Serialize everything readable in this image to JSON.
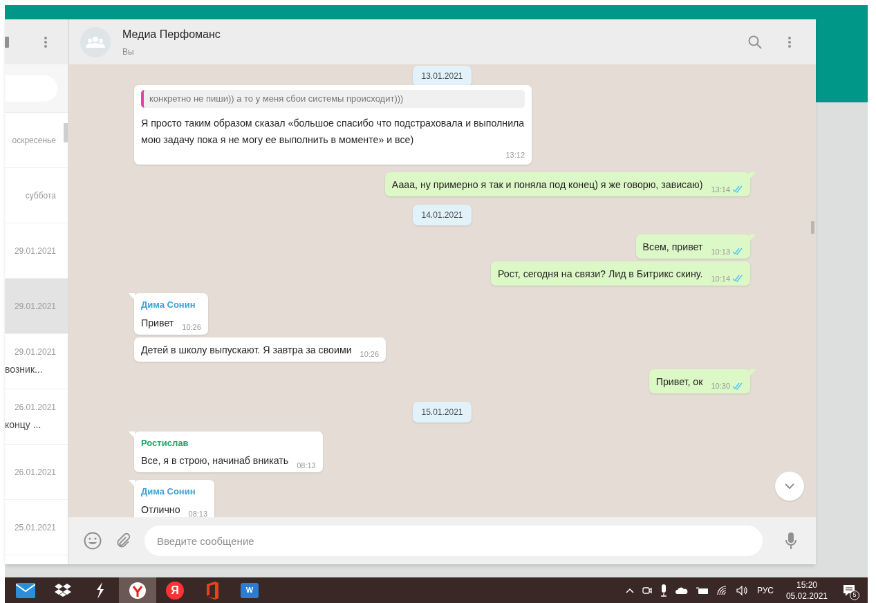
{
  "sidebar": {
    "items": [
      {
        "date": "оскресенье",
        "selected": false
      },
      {
        "date": "суббота",
        "selected": false
      },
      {
        "date": "29.01.2021",
        "selected": false
      },
      {
        "date": "29.01.2021",
        "selected": true
      },
      {
        "date": "29.01.2021",
        "preview": "возник...",
        "selected": false
      },
      {
        "date": "26.01.2021",
        "preview": "концу ...",
        "selected": false
      },
      {
        "date": "26.01.2021",
        "selected": false
      },
      {
        "date": "25.01.2021",
        "selected": false
      }
    ]
  },
  "chat": {
    "title": "Медиа Перфоманс",
    "subtitle": "Вы",
    "messages": [
      {
        "kind": "date",
        "text": "13.01.2021"
      },
      {
        "kind": "in",
        "quote": "конкретно не пиши)) а то у меня сбои системы происходит)))",
        "text": "Я просто таким образом сказал «большое спасибо что подстраховала и выполнила мою задачу пока я не могу ее выполнить в моменте» и все)",
        "time": "13:12",
        "tail": false
      },
      {
        "kind": "out",
        "text": "Аааа, ну примерно я так и поняла под конец) я же говорю, зависаю)",
        "time": "13:14",
        "tail": true
      },
      {
        "kind": "date",
        "text": "14.01.2021"
      },
      {
        "kind": "out",
        "text": "Всем, привет",
        "time": "10:13",
        "tail": true
      },
      {
        "kind": "out",
        "text": "Рост, сегодня на связи? Лид в Битрикс скину.",
        "time": "10:14",
        "tail": false
      },
      {
        "kind": "in",
        "sender": "Дима Сонин",
        "color": "#35a3d5",
        "text": "Привет",
        "time": "10:26",
        "tail": true
      },
      {
        "kind": "in",
        "text": "Детей в школу выпускают. Я завтра за своими",
        "time": "10:26",
        "tail": false
      },
      {
        "kind": "out",
        "text": "Привет, ок",
        "time": "10:30",
        "tail": true
      },
      {
        "kind": "date",
        "text": "15.01.2021"
      },
      {
        "kind": "in",
        "sender": "Ростислав",
        "color": "#1fa463",
        "text": "Все, я в строю, начинаб вникать",
        "time": "08:13",
        "tail": true
      },
      {
        "kind": "in",
        "sender": "Дима Сонин",
        "color": "#35a3d5",
        "text": "Отлично",
        "time": "08:13",
        "tail": true
      }
    ],
    "composer": {
      "placeholder": "Введите сообщение"
    }
  },
  "taskbar": {
    "apps": [
      {
        "kind": "mail",
        "selected": false
      },
      {
        "kind": "dropbox",
        "selected": false
      },
      {
        "kind": "bolt",
        "selected": false
      },
      {
        "kind": "browser",
        "selected": true
      },
      {
        "kind": "letter",
        "glyph": "Я",
        "selected": false
      },
      {
        "kind": "office",
        "selected": false
      },
      {
        "kind": "word",
        "glyph": "W",
        "selected": false
      }
    ],
    "language": "РУС",
    "time": "15:20",
    "date": "05.02.2021",
    "notifications": "5"
  }
}
